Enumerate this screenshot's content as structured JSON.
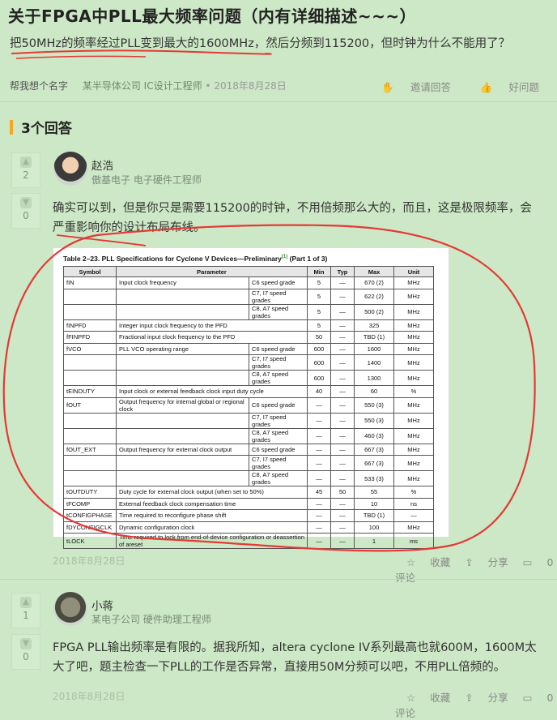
{
  "question": {
    "title": "关于FPGA中PLL最大频率问题（内有详细描述~~~）",
    "description": "把50MHz的频率经过PLL变到最大的1600MHz，然后分频到115200，但时钟为什么不能用了？",
    "author": "帮我想个名字",
    "company": "某半导体公司 IC设计工程师",
    "date": "2018年8月28日",
    "invite_label": "邀请回答",
    "good_label": "好问题"
  },
  "answers_header": "3个回答",
  "answers": [
    {
      "name": "赵浩",
      "title": "傲基电子 电子硬件工程师",
      "up": "2",
      "down": "0",
      "text": "确实可以到，但是你只是需要115200的时钟，不用倍频那么大的，而且，这是极限频率，会严重影响你的设计布局布线。",
      "date": "2018年8月28日",
      "collect": "收藏",
      "share": "分享",
      "comment": "0评论"
    },
    {
      "name": "小蒋",
      "title": "某电子公司 硬件助理工程师",
      "up": "1",
      "down": "0",
      "text": "FPGA PLL输出频率是有限的。据我所知，altera cyclone IV系列最高也就600M，1600M太大了吧，题主检查一下PLL的工作是否异常，直接用50M分频可以吧，不用PLL倍频的。",
      "date": "2018年8月28日",
      "collect": "收藏",
      "share": "分享",
      "comment": "0评论"
    }
  ],
  "table": {
    "caption": "Table 2–23.  PLL Specifications for Cyclone V Devices—Preliminary",
    "caption_sup": "(1)",
    "caption_tail": " (Part 1 of 3)",
    "headers": [
      "Symbol",
      "Parameter",
      "Min",
      "Typ",
      "Max",
      "Unit"
    ],
    "rows": [
      {
        "sym": "fIN",
        "param": "Input clock frequency",
        "sub": "C6 speed grade",
        "min": "5",
        "typ": "—",
        "max": "670 (2)",
        "unit": "MHz"
      },
      {
        "sym": "",
        "param": "",
        "sub": "C7, I7 speed grades",
        "min": "5",
        "typ": "—",
        "max": "622 (2)",
        "unit": "MHz"
      },
      {
        "sym": "",
        "param": "",
        "sub": "C8, A7 speed grades",
        "min": "5",
        "typ": "—",
        "max": "500 (2)",
        "unit": "MHz"
      },
      {
        "sym": "fINPFD",
        "param": "Integer input clock frequency to the PFD",
        "sub": "",
        "min": "5",
        "typ": "—",
        "max": "325",
        "unit": "MHz"
      },
      {
        "sym": "fFINPFD",
        "param": "Fractional input clock frequency to the PFD",
        "sub": "",
        "min": "50",
        "typ": "—",
        "max": "TBD (1)",
        "unit": "MHz"
      },
      {
        "sym": "fVCO",
        "param": "PLL VCO operating range",
        "sub": "C6 speed grade",
        "min": "600",
        "typ": "—",
        "max": "1600",
        "unit": "MHz"
      },
      {
        "sym": "",
        "param": "",
        "sub": "C7, I7 speed grades",
        "min": "600",
        "typ": "—",
        "max": "1400",
        "unit": "MHz"
      },
      {
        "sym": "",
        "param": "",
        "sub": "C8, A7 speed grades",
        "min": "600",
        "typ": "—",
        "max": "1300",
        "unit": "MHz"
      },
      {
        "sym": "tEINDUTY",
        "param": "Input clock or external feedback clock input duty cycle",
        "sub": "",
        "min": "40",
        "typ": "—",
        "max": "60",
        "unit": "%"
      },
      {
        "sym": "fOUT",
        "param": "Output frequency for internal global or regional clock",
        "sub": "C6 speed grade",
        "min": "—",
        "typ": "—",
        "max": "550 (3)",
        "unit": "MHz"
      },
      {
        "sym": "",
        "param": "",
        "sub": "C7, I7 speed grades",
        "min": "—",
        "typ": "—",
        "max": "550 (3)",
        "unit": "MHz"
      },
      {
        "sym": "",
        "param": "",
        "sub": "C8, A7 speed grades",
        "min": "—",
        "typ": "—",
        "max": "460 (3)",
        "unit": "MHz"
      },
      {
        "sym": "fOUT_EXT",
        "param": "Output frequency for external clock output",
        "sub": "C6 speed grade",
        "min": "—",
        "typ": "—",
        "max": "667 (3)",
        "unit": "MHz"
      },
      {
        "sym": "",
        "param": "",
        "sub": "C7, I7 speed grades",
        "min": "—",
        "typ": "—",
        "max": "667 (3)",
        "unit": "MHz"
      },
      {
        "sym": "",
        "param": "",
        "sub": "C8, A7 speed grades",
        "min": "—",
        "typ": "—",
        "max": "533 (3)",
        "unit": "MHz"
      },
      {
        "sym": "tOUTDUTY",
        "param": "Duty cycle for external clock output (when set to 50%)",
        "sub": "",
        "min": "45",
        "typ": "50",
        "max": "55",
        "unit": "%"
      },
      {
        "sym": "tFCOMP",
        "param": "External feedback clock compensation time",
        "sub": "",
        "min": "—",
        "typ": "—",
        "max": "10",
        "unit": "ns"
      },
      {
        "sym": "tCONFIGPHASE",
        "param": "Time required to reconfigure phase shift",
        "sub": "",
        "min": "—",
        "typ": "—",
        "max": "TBD (1)",
        "unit": "—"
      },
      {
        "sym": "fDYCONFIGCLK",
        "param": "Dynamic configuration clock",
        "sub": "",
        "min": "—",
        "typ": "—",
        "max": "100",
        "unit": "MHz"
      },
      {
        "sym": "tLOCK",
        "param": "Time required to lock from end-of-device configuration or deassertion of areset",
        "sub": "",
        "min": "—",
        "typ": "—",
        "max": "1",
        "unit": "ms"
      }
    ]
  },
  "colors": {
    "background": "#cde8c6",
    "accent": "#f5a623",
    "annotation": "#e53935"
  }
}
